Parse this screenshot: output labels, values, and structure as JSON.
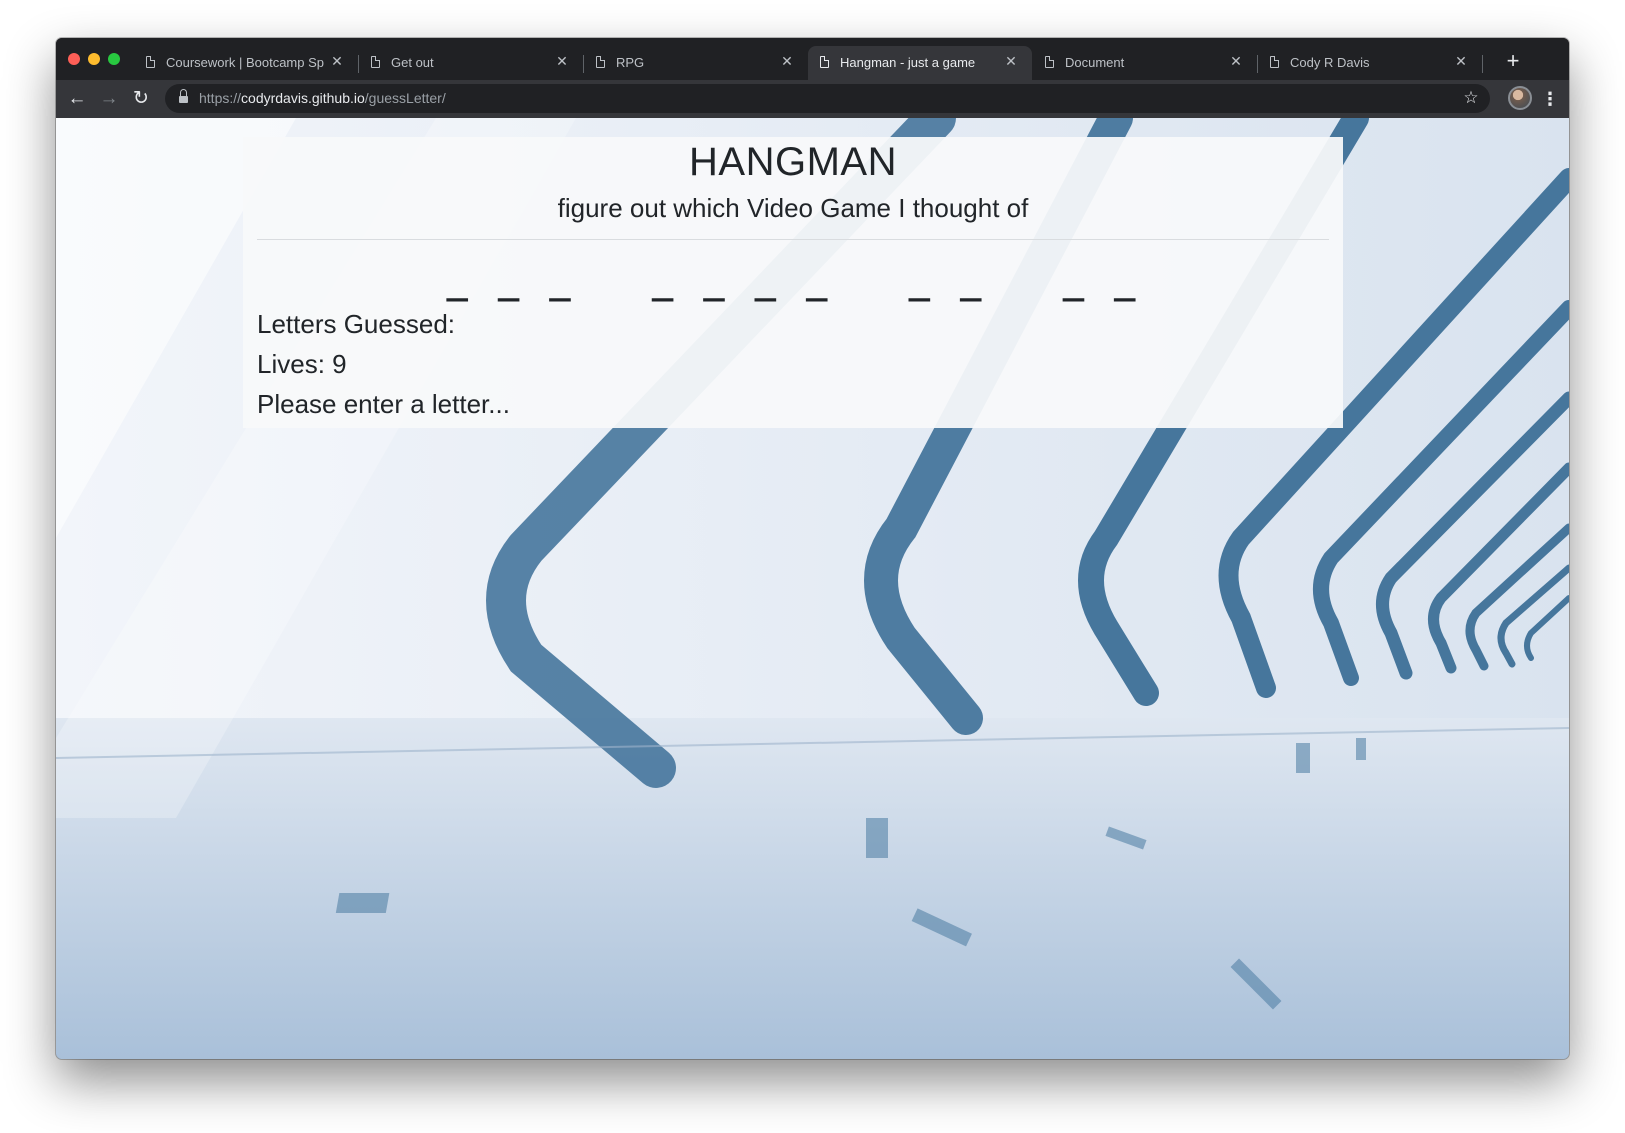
{
  "browser": {
    "tabs": [
      {
        "title": "Coursework | Bootcamp Spot",
        "active": false
      },
      {
        "title": "Get out",
        "active": false
      },
      {
        "title": "RPG",
        "active": false
      },
      {
        "title": "Hangman - just a game",
        "active": true
      },
      {
        "title": "Document",
        "active": false
      },
      {
        "title": "Cody R Davis",
        "active": false
      }
    ],
    "tab_close_symbol": "✕",
    "new_tab_symbol": "+",
    "back_icon": "←",
    "forward_icon": "→",
    "reload_icon": "↻",
    "star_icon": "☆",
    "menu_icon": "⋮",
    "url": {
      "scheme": "https://",
      "host": "codyrdavis.github.io",
      "path": "/guessLetter/"
    }
  },
  "game": {
    "title": "HANGMAN",
    "subtitle": "figure out which Video Game I thought of",
    "word_display": "_ _ _   _ _ _ _   _ _   _ _",
    "letters_guessed_label": "Letters Guessed:",
    "lives_text": "Lives: 9",
    "prompt": "Please enter a letter..."
  },
  "colors": {
    "chrome_dark": "#202124",
    "chrome_toolbar": "#35363a",
    "panel_bg": "#f8f9fa",
    "text": "#212529",
    "architecture_blue": "#3f6f96"
  }
}
